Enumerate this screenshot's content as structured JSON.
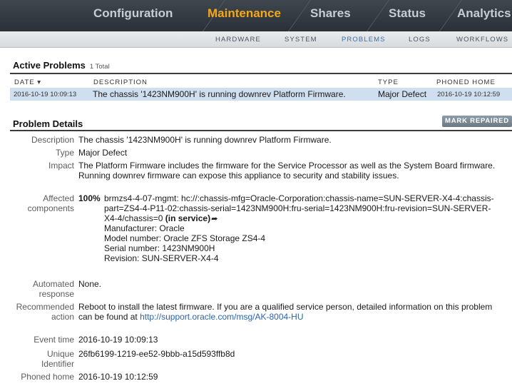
{
  "nav": {
    "tabs": [
      "Configuration",
      "Maintenance",
      "Shares",
      "Status",
      "Analytics"
    ],
    "active_tab": "Maintenance",
    "subtabs": [
      "HARDWARE",
      "SYSTEM",
      "PROBLEMS",
      "LOGS",
      "WORKFLOWS"
    ],
    "active_subtab": "PROBLEMS"
  },
  "active_problems": {
    "title": "Active Problems",
    "count": "1 Total",
    "columns": {
      "date": "DATE",
      "date_sort": "▾",
      "description": "DESCRIPTION",
      "type": "TYPE",
      "phoned_home": "PHONED HOME"
    },
    "rows": [
      {
        "date": "2016-10-19 10:09:13",
        "description": "The chassis '1423NM900H' is running downrev Platform Firmware.",
        "type": "Major Defect",
        "phoned_home": "2016-10-19 10:12:59"
      }
    ]
  },
  "details": {
    "title": "Problem Details",
    "mark_repaired": "MARK REPAIRED",
    "labels": {
      "description": "Description",
      "type": "Type",
      "impact": "Impact",
      "affected_1": "Affected",
      "affected_2": "components",
      "automated_1": "Automated",
      "automated_2": "response",
      "recommended_1": "Recommended",
      "recommended_2": "action",
      "event_time": "Event time",
      "unique_1": "Unique",
      "unique_2": "Identifier",
      "phoned_home": "Phoned home"
    },
    "description": "The chassis '1423NM900H' is running downrev Platform Firmware.",
    "type": "Major Defect",
    "impact_line1": "The Platform Firmware includes the firmware for the Service Processor as well as the System Board firmware.",
    "impact_line2": "Running downrev firmware can expose this appliance to security and stability issues.",
    "affected_percent": "100%",
    "component_line1": "brmzs4-4-07-mgmt: hc://:chassis-mfg=Oracle-Corporation:chassis-name=SUN-SERVER-X4-4:chassis-",
    "component_line2": "part=ZS4-4-P11-02:chassis-serial=1423NM900H:fru-serial=1423NM900H:fru-revision=SUN-SERVER-",
    "component_line3": "X4-4/chassis=0",
    "component_status": "(in service)",
    "component_manufacturer": "Manufacturer: Oracle",
    "component_model": "Model number: Oracle ZFS Storage ZS4-4",
    "component_serial": "Serial number: 1423NM900H",
    "component_revision": "Revision: SUN-SERVER-X4-4",
    "automated_response": "None.",
    "recommended_line1": "Reboot to install the latest firmware. If you are a qualified service person, detailed information on this problem",
    "recommended_line2_prefix": "can be found at",
    "recommended_link": "http://support.oracle.com/msg/AK-8004-HU",
    "event_time": "2016-10-19 10:09:13",
    "unique_identifier": "26fb6199-1219-ee52-9bbb-a15d593ffb8d",
    "phoned_home": "2016-10-19 10:12:59"
  }
}
